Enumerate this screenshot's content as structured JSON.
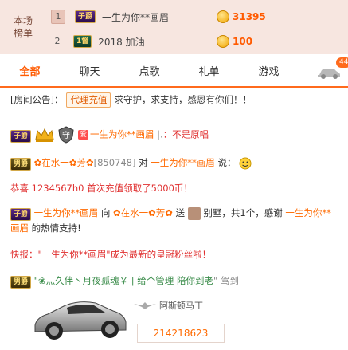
{
  "ranking": {
    "label_line1": "本场",
    "label_line2": "榜单",
    "rows": [
      {
        "rank": "1",
        "badge": "子爵",
        "name": "一生为你**画眉",
        "value": "31395"
      },
      {
        "rank": "2",
        "badge": "1督",
        "name": "2018 加油",
        "value": "100"
      }
    ]
  },
  "tabs": [
    "全部",
    "聊天",
    "点歌",
    "礼单",
    "游戏"
  ],
  "car_badge": "44",
  "chat": {
    "announce_prefix": "[房间公告]：",
    "announce_button": "代理充值",
    "announce_text": "求守护，求支持，感恩有你们！！",
    "row1": {
      "badge": "子爵",
      "fan_badge": "爱",
      "name": "一生为你**画眉",
      "sep": "|.",
      "text": "：不是原唱"
    },
    "row2": {
      "badge": "男爵",
      "name": "✿在水一✿芳✿",
      "id": "[850748]",
      "mid": "对",
      "target": "一生为你**画眉",
      "say": "说："
    },
    "row3": {
      "text": "恭喜 1234567h0 首次充值领取了5000币！"
    },
    "row4": {
      "badge": "子爵",
      "name": "一生为你**画眉",
      "to": "向",
      "target": "✿在水一✿芳✿",
      "send": "送",
      "gift": "别墅，共1个，感谢",
      "thanks_name": "一生为你**",
      "line2_name": "画眉",
      "line2_text": "的热情支持!"
    },
    "row5": {
      "text": "快报：\"一生为你**画眉\"成为最新的皇冠粉丝啦！"
    },
    "row6": {
      "badge": "男爵",
      "name": "\"❀灬久伴丶月夜孤魂￥",
      "mid": "| 给个管理 陪你到老",
      "end": "\" 驾到"
    },
    "car": {
      "brand": "阿斯顿马丁",
      "code": "214218623"
    }
  },
  "colors": {
    "accent": "#ff5a00",
    "rank_bg": "#f7e6e0"
  }
}
